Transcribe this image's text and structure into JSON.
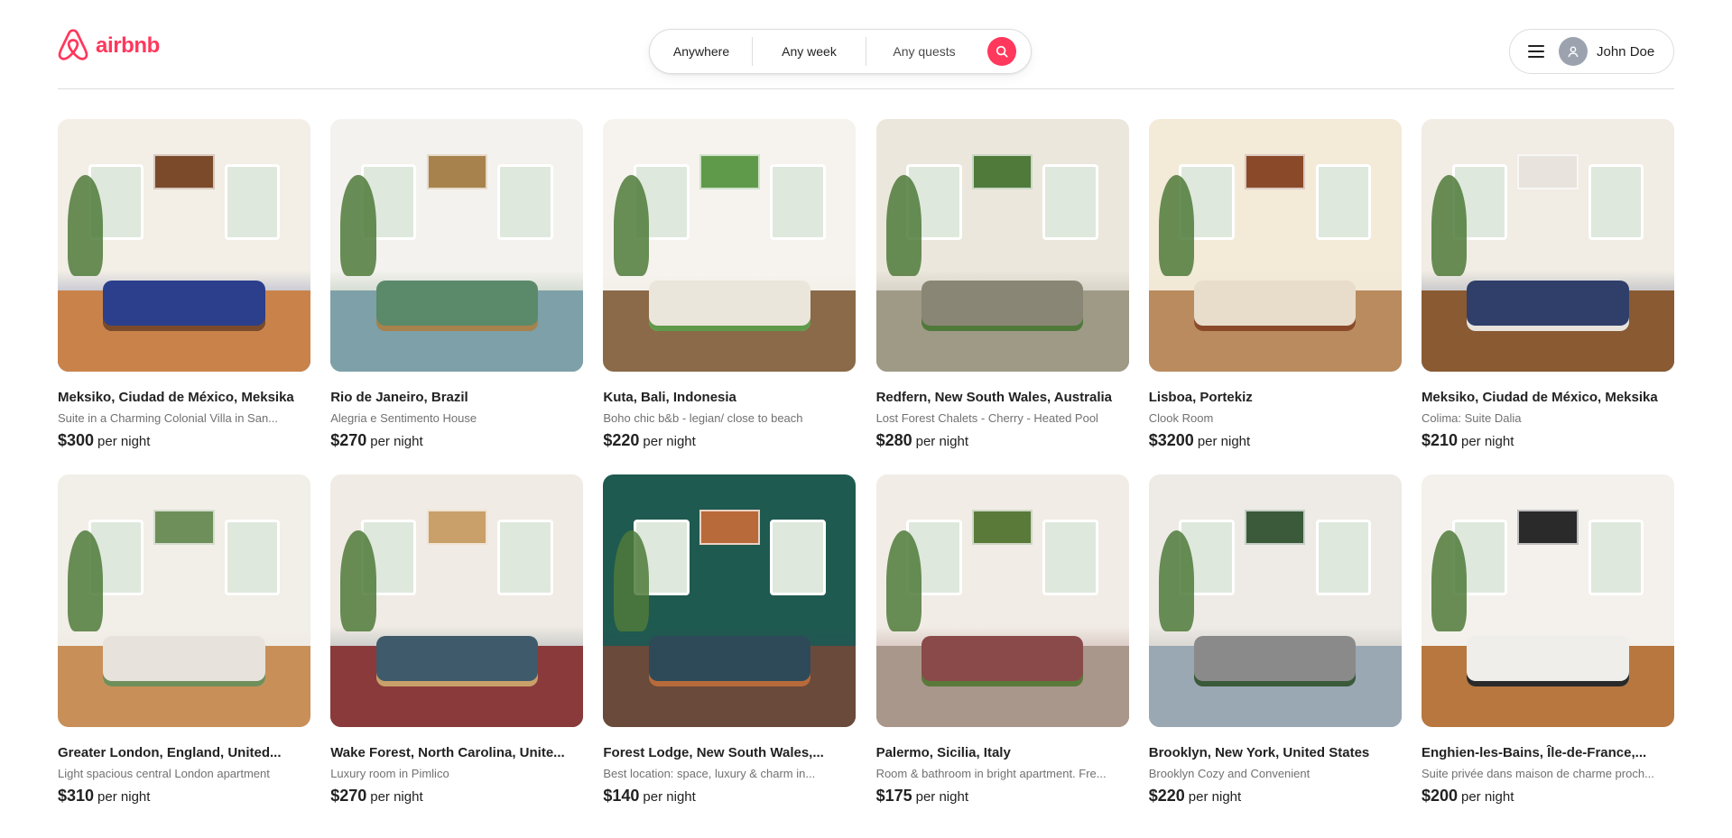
{
  "brand": {
    "name": "airbnb",
    "color": "#ff385c",
    "icon": "airbnb-logo-icon"
  },
  "search": {
    "where": "Anywhere",
    "when": "Any week",
    "who": "Any quests",
    "button_icon": "search-icon"
  },
  "user": {
    "menu_icon": "hamburger-icon",
    "avatar_icon": "user-icon",
    "name": "John Doe"
  },
  "per_night_label": "per night",
  "listings": [
    {
      "title": "Meksiko, Ciudad de México, Meksika",
      "subtitle": "Suite in a Charming Colonial Villa in San...",
      "price": "$300"
    },
    {
      "title": "Rio de Janeiro, Brazil",
      "subtitle": "Alegria e Sentimento House",
      "price": "$270"
    },
    {
      "title": "Kuta, Bali, Indonesia",
      "subtitle": "Boho chic b&b - legian/ close to beach",
      "price": "$220"
    },
    {
      "title": "Redfern, New South Wales, Australia",
      "subtitle": "Lost Forest Chalets - Cherry - Heated Pool",
      "price": "$280"
    },
    {
      "title": "Lisboa, Portekiz",
      "subtitle": "Clook Room",
      "price": "$3200"
    },
    {
      "title": "Meksiko, Ciudad de México, Meksika",
      "subtitle": "Colima: Suite Dalia",
      "price": "$210"
    },
    {
      "title": "Greater London, England, United...",
      "subtitle": "Light spacious central London apartment",
      "price": "$310"
    },
    {
      "title": "Wake Forest, North Carolina, Unite...",
      "subtitle": "Luxury room in Pimlico",
      "price": "$270"
    },
    {
      "title": "Forest Lodge, New South Wales,...",
      "subtitle": "Best location: space, luxury & charm in...",
      "price": "$140"
    },
    {
      "title": "Palermo, Sicilia, Italy",
      "subtitle": "Room & bathroom in bright apartment. Fre...",
      "price": "$175"
    },
    {
      "title": "Brooklyn, New York, United States",
      "subtitle": "Brooklyn Cozy and Convenient",
      "price": "$220"
    },
    {
      "title": "Enghien-les-Bains, Île-de-France,...",
      "subtitle": "Suite privée dans maison de charme proch...",
      "price": "$200"
    }
  ]
}
